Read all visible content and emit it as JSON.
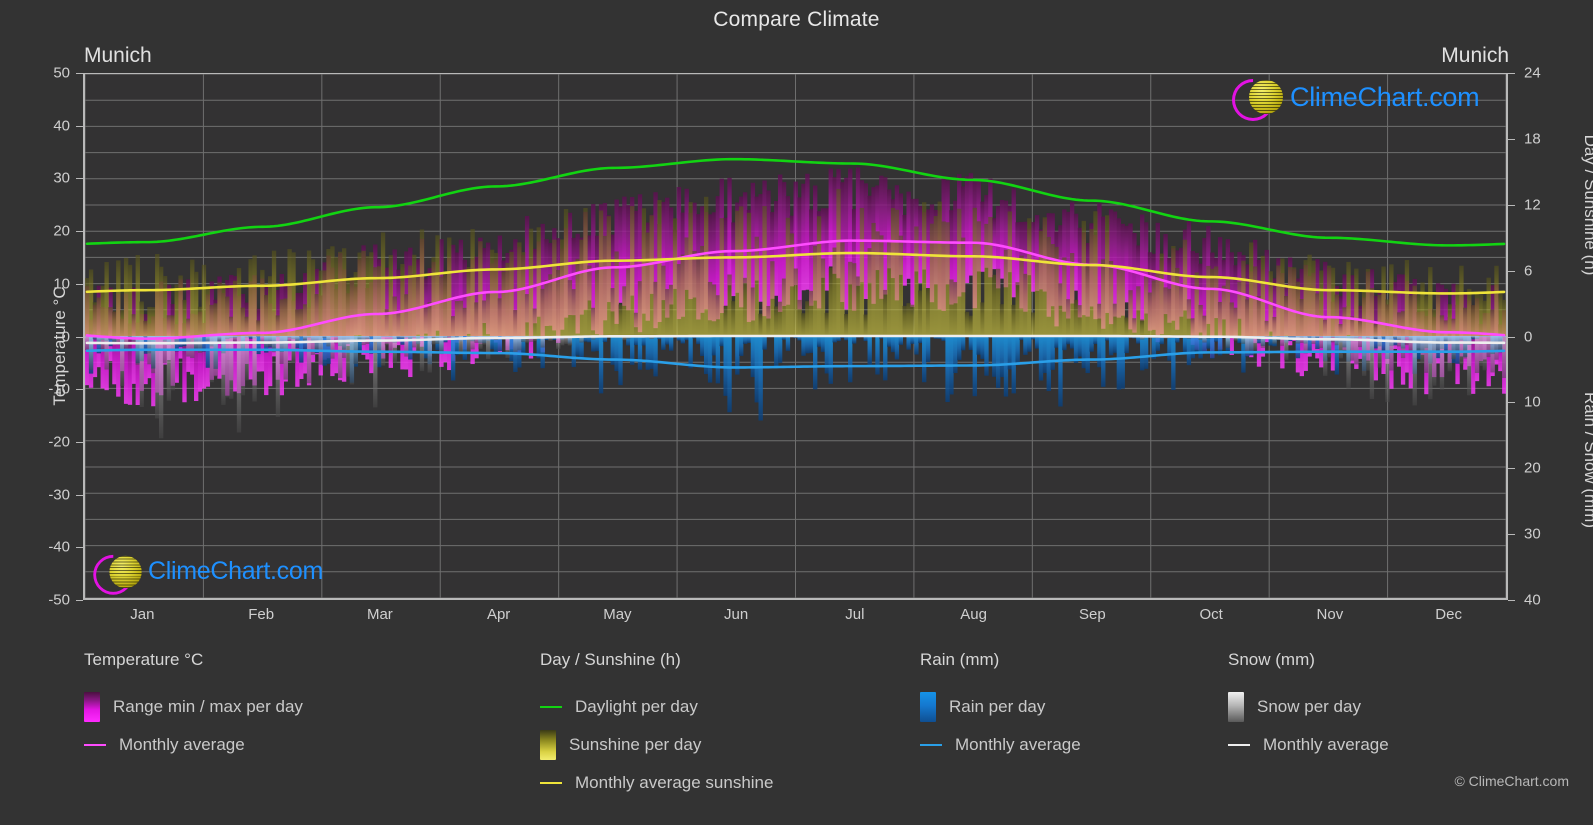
{
  "header": {
    "title": "Compare Climate",
    "location_left": "Munich",
    "location_right": "Munich"
  },
  "brand": {
    "name": "ClimeChart.com",
    "copyright": "© ClimeChart.com",
    "logo_arc_color": "#e312e3",
    "logo_ball_color": "#ded433",
    "logo_text_color": "#1e90ff"
  },
  "axes": {
    "left": {
      "label": "Temperature °C",
      "ticks": [
        "50",
        "40",
        "30",
        "20",
        "10",
        "0",
        "-10",
        "-20",
        "-30",
        "-40",
        "-50"
      ],
      "min": -50,
      "max": 50,
      "step": 10
    },
    "right_top": {
      "label": "Day / Sunshine (h)",
      "ticks": [
        "24",
        "18",
        "12",
        "6",
        "0"
      ],
      "min": 0,
      "max": 24,
      "step": 6
    },
    "right_bottom": {
      "label": "Rain / Snow (mm)",
      "ticks": [
        "0",
        "10",
        "20",
        "30",
        "40"
      ],
      "min": 0,
      "max": 40,
      "step": 10
    },
    "x": {
      "label": "",
      "ticks": [
        "Jan",
        "Feb",
        "Mar",
        "Apr",
        "May",
        "Jun",
        "Jul",
        "Aug",
        "Sep",
        "Oct",
        "Nov",
        "Dec"
      ]
    }
  },
  "legend": {
    "groups": [
      {
        "title": "Temperature °C",
        "items": [
          {
            "label": "Range min / max per day",
            "marker": "swatch",
            "style": "temp"
          },
          {
            "label": "Monthly average",
            "marker": "line",
            "style": "temp"
          }
        ]
      },
      {
        "title": "Day / Sunshine (h)",
        "items": [
          {
            "label": "Daylight per day",
            "marker": "line",
            "style": "day"
          },
          {
            "label": "Sunshine per day",
            "marker": "swatch",
            "style": "sun"
          },
          {
            "label": "Monthly average sunshine",
            "marker": "line",
            "style": "sun"
          }
        ]
      },
      {
        "title": "Rain (mm)",
        "items": [
          {
            "label": "Rain per day",
            "marker": "swatch",
            "style": "rain"
          },
          {
            "label": "Monthly average",
            "marker": "line",
            "style": "rain"
          }
        ]
      },
      {
        "title": "Snow (mm)",
        "items": [
          {
            "label": "Snow per day",
            "marker": "swatch",
            "style": "snow"
          },
          {
            "label": "Monthly average",
            "marker": "line",
            "style": "snow"
          }
        ]
      }
    ]
  },
  "chart_data": {
    "type": "line",
    "title": "Compare Climate",
    "subtitle": "Munich",
    "xlabel": "",
    "ylabel": "Temperature °C",
    "ylim": [
      -50,
      50
    ],
    "y2lim_top": [
      0,
      24
    ],
    "y2lim_bottom": [
      0,
      40
    ],
    "grid": true,
    "legend_position": "bottom",
    "categories": [
      "Jan",
      "Feb",
      "Mar",
      "Apr",
      "May",
      "Jun",
      "Jul",
      "Aug",
      "Sep",
      "Oct",
      "Nov",
      "Dec"
    ],
    "series": [
      {
        "name": "Daylight per day",
        "unit": "h",
        "axis": "right_top",
        "color": "#12d412",
        "values": [
          8.6,
          10.0,
          11.8,
          13.7,
          15.4,
          16.2,
          15.8,
          14.3,
          12.4,
          10.5,
          9.0,
          8.3
        ]
      },
      {
        "name": "Monthly average sunshine",
        "unit": "h",
        "axis": "right_top",
        "color": "#efe43a",
        "values": [
          4.2,
          4.6,
          5.3,
          6.1,
          6.9,
          7.2,
          7.6,
          7.3,
          6.5,
          5.4,
          4.2,
          3.9
        ]
      },
      {
        "name": "Monthly average temperature",
        "unit": "°C",
        "axis": "left",
        "color": "#ff4cff",
        "values": [
          -0.5,
          0.6,
          4.2,
          8.4,
          13.1,
          16.2,
          18.2,
          17.8,
          13.6,
          9.0,
          3.6,
          0.7
        ]
      },
      {
        "name": "Monthly average rain",
        "unit": "mm",
        "axis": "right_bottom",
        "color": "#2a9fe8",
        "values": [
          2.1,
          2.1,
          2.4,
          2.6,
          3.6,
          4.8,
          4.6,
          4.5,
          3.6,
          2.5,
          2.4,
          2.4
        ]
      },
      {
        "name": "Monthly average snow",
        "unit": "mm",
        "axis": "right_bottom",
        "color": "#eeeeee",
        "values": [
          1.1,
          1.0,
          0.7,
          0.3,
          0.05,
          0.0,
          0.0,
          0.0,
          0.0,
          0.1,
          0.5,
          1.0
        ]
      }
    ],
    "daily_range_temperature": {
      "name": "Range min / max per day",
      "axis": "left",
      "color": "#e516e5",
      "min": [
        -9,
        -8,
        -4,
        -1,
        3,
        7,
        9,
        9,
        5,
        0,
        -4,
        -7
      ],
      "max": [
        6,
        8,
        13,
        18,
        23,
        26,
        28,
        27,
        22,
        17,
        10,
        6
      ]
    }
  }
}
